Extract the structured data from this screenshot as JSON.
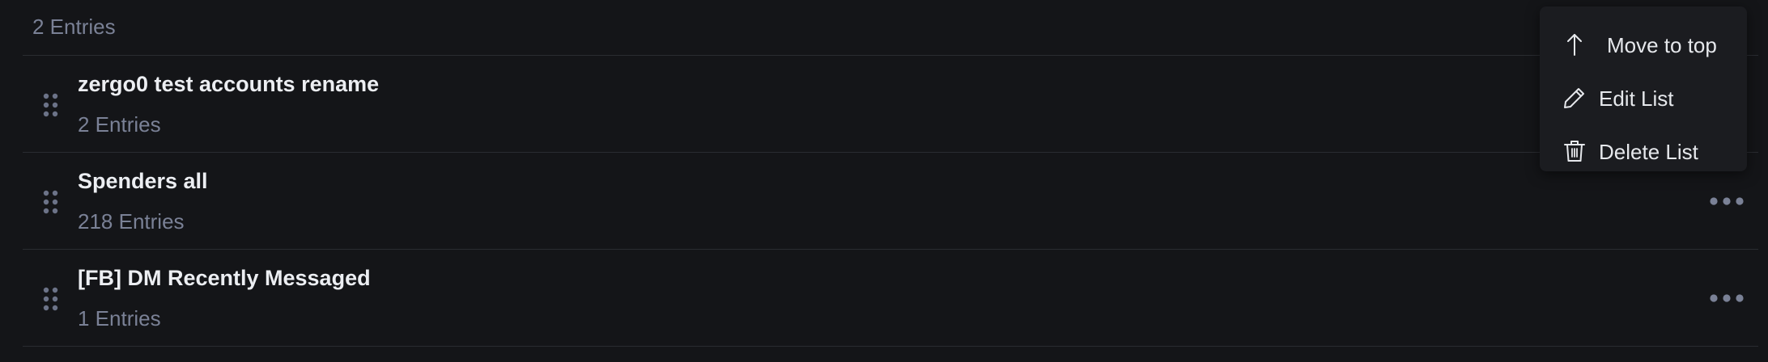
{
  "header": {
    "count_label": "2 Entries"
  },
  "lists": [
    {
      "name": "zergo0 test accounts rename",
      "entries": "2 Entries"
    },
    {
      "name": "Spenders all",
      "entries": "218 Entries"
    },
    {
      "name": "[FB] DM Recently Messaged",
      "entries": "1 Entries"
    }
  ],
  "menu": {
    "items": [
      {
        "label": "Move to top",
        "icon": "arrow-up-icon"
      },
      {
        "label": "Edit List",
        "icon": "pencil-icon"
      },
      {
        "label": "Delete List",
        "icon": "trash-icon"
      }
    ]
  },
  "colors": {
    "background": "#141518",
    "text_primary": "#eceef2",
    "text_secondary": "#7a8196",
    "divider": "#2a2c31",
    "menu_background": "#1b1c20"
  }
}
